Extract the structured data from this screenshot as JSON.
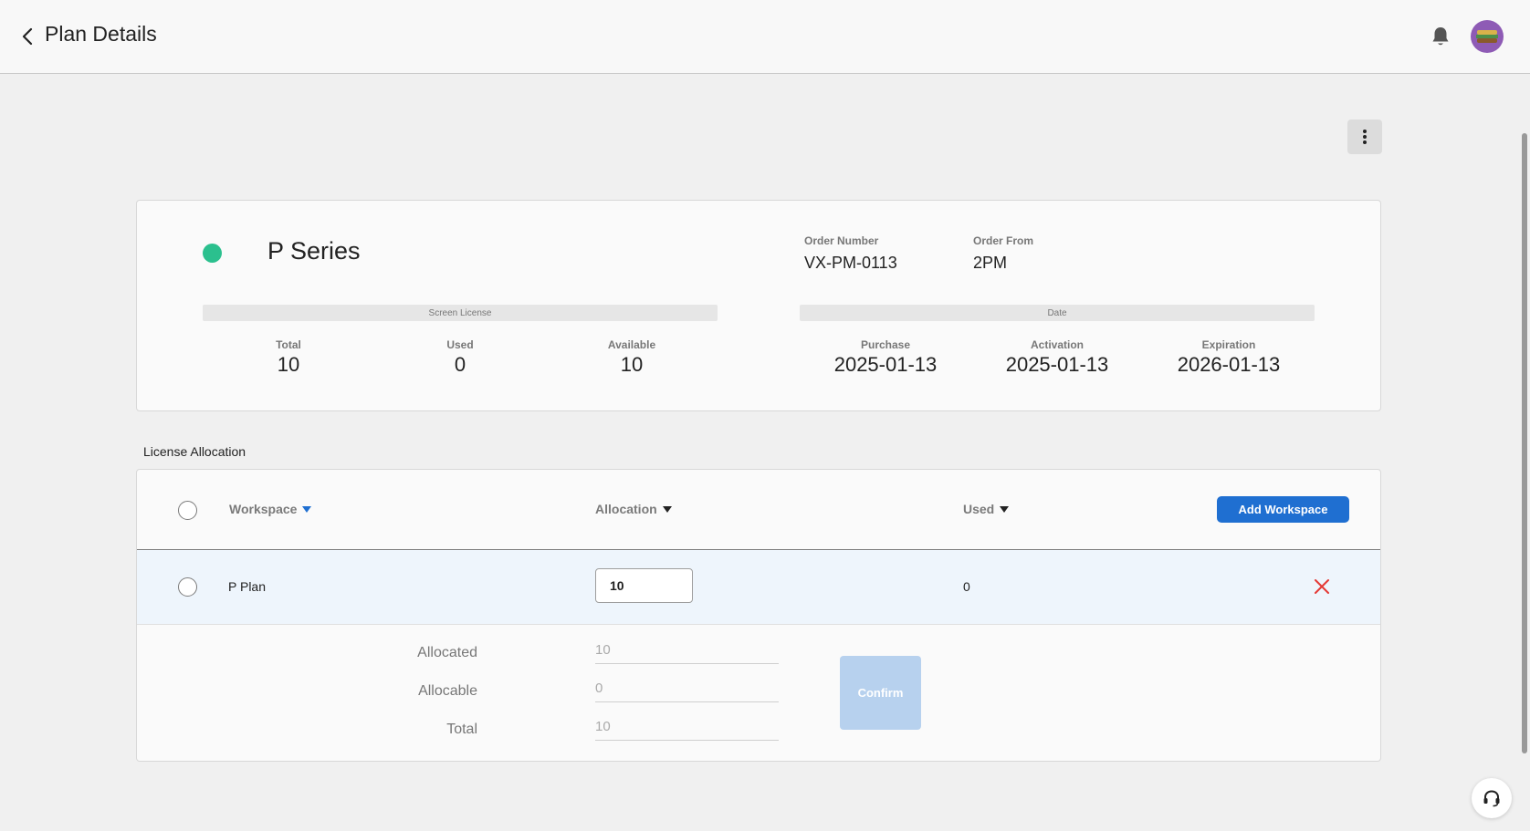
{
  "header": {
    "title": "Plan Details"
  },
  "plan": {
    "name": "P Series",
    "status_color": "#2bc08e",
    "order_number_label": "Order Number",
    "order_number": "VX-PM-0113",
    "order_from_label": "Order From",
    "order_from": "2PM",
    "screen_license": {
      "section_label": "Screen License",
      "total_label": "Total",
      "total": "10",
      "used_label": "Used",
      "used": "0",
      "available_label": "Available",
      "available": "10"
    },
    "date": {
      "section_label": "Date",
      "purchase_label": "Purchase",
      "purchase": "2025-01-13",
      "activation_label": "Activation",
      "activation": "2025-01-13",
      "expiration_label": "Expiration",
      "expiration": "2026-01-13"
    }
  },
  "allocation": {
    "section_title": "License Allocation",
    "columns": {
      "workspace": "Workspace",
      "allocation": "Allocation",
      "used": "Used"
    },
    "add_button": "Add Workspace",
    "rows": [
      {
        "workspace": "P Plan",
        "allocation": "10",
        "used": "0"
      }
    ],
    "summary": {
      "allocated_label": "Allocated",
      "allocated": "10",
      "allocable_label": "Allocable",
      "allocable": "0",
      "total_label": "Total",
      "total": "10"
    },
    "confirm_button": "Confirm"
  },
  "colors": {
    "accent": "#1f6fd1",
    "delete": "#e53935",
    "confirm_disabled": "#b7d1ee",
    "row_highlight": "#eef5fc"
  },
  "icons": {
    "back": "chevron-left-icon",
    "bell": "bell-icon",
    "avatar": "avatar",
    "more": "more-vertical-icon",
    "delete": "close-icon",
    "support": "headset-icon"
  }
}
